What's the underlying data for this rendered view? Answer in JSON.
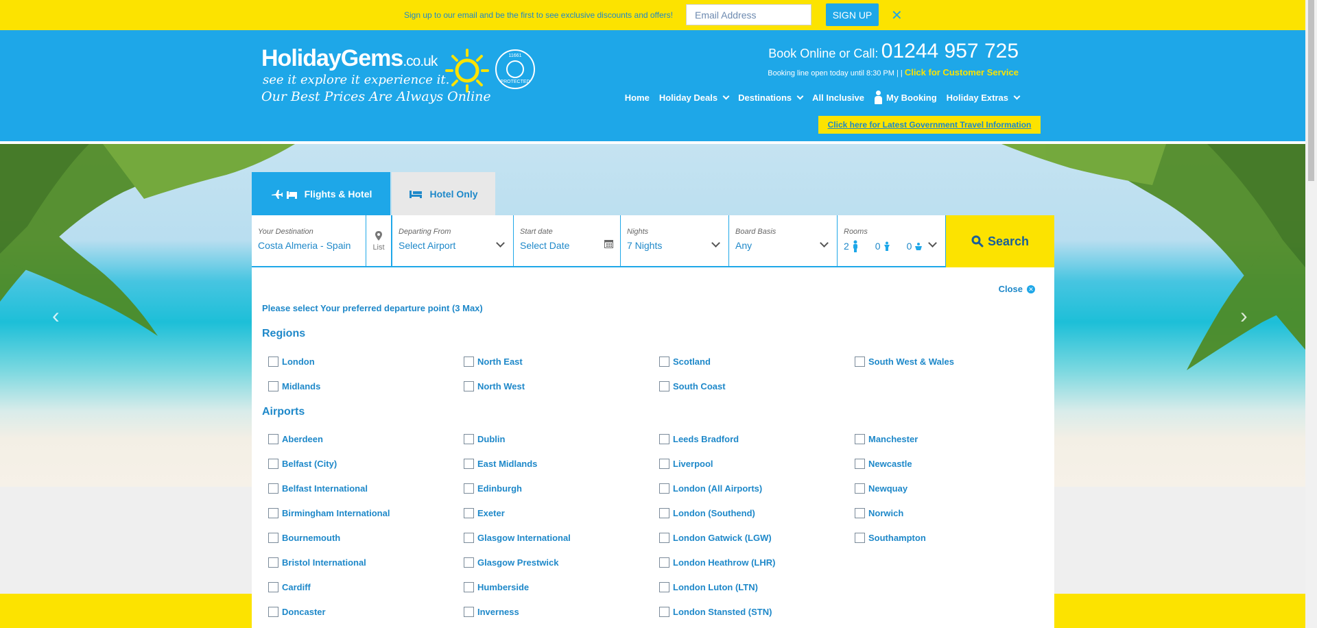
{
  "promo": {
    "text": "Sign up to our email and be the first to see exclusive discounts and offers!",
    "email_placeholder": "Email Address",
    "signup_label": "SIGN UP",
    "close_label": "✕"
  },
  "header": {
    "logo_main": "HolidayGems",
    "logo_tld": ".co.uk",
    "logo_sub": "see it  explore it  experience it.",
    "logo_tag": "Our Best Prices Are Always Online",
    "atol_number": "11661",
    "atol_text": "PROTECTED",
    "book_label": "Book Online or Call:",
    "phone": "01244 957 725",
    "booking_line": "Booking line open today until 8:30 PM | |",
    "customer_service": "Click for Customer Service",
    "nav": {
      "home": "Home",
      "holiday_deals": "Holiday Deals",
      "destinations": "Destinations",
      "all_inclusive": "All Inclusive",
      "my_booking": "My Booking",
      "holiday_extras": "Holiday Extras"
    },
    "gov_info": "Click here for Latest Government Travel Information"
  },
  "search": {
    "tab_flights_hotel": "Flights & Hotel",
    "tab_hotel_only": "Hotel Only",
    "destination_label": "Your Destination",
    "destination_value": "Costa Almeria - Spain",
    "list_label": "List",
    "departing_label": "Departing From",
    "departing_value": "Select Airport",
    "start_label": "Start date",
    "start_value": "Select Date",
    "nights_label": "Nights",
    "nights_value": "7 Nights",
    "board_label": "Board Basis",
    "board_value": "Any",
    "rooms_label": "Rooms",
    "adults": "2",
    "children": "0",
    "infants": "0",
    "search_label": "Search"
  },
  "panel": {
    "close_label": "Close",
    "instruction": "Please select Your preferred departure point (3 Max)",
    "regions_title": "Regions",
    "airports_title": "Airports",
    "regions": [
      "London",
      "North East",
      "Scotland",
      "South West & Wales",
      "Midlands",
      "North West",
      "South Coast"
    ],
    "airports": [
      "Aberdeen",
      "Dublin",
      "Leeds Bradford",
      "Manchester",
      "Belfast (City)",
      "East Midlands",
      "Liverpool",
      "Newcastle",
      "Belfast International",
      "Edinburgh",
      "London (All Airports)",
      "Newquay",
      "Birmingham International",
      "Exeter",
      "London (Southend)",
      "Norwich",
      "Bournemouth",
      "Glasgow International",
      "London Gatwick (LGW)",
      "Southampton",
      "Bristol International",
      "Glasgow Prestwick",
      "London Heathrow (LHR)",
      "Cardiff",
      "Humberside",
      "London Luton (LTN)",
      "Doncaster",
      "Inverness",
      "London Stansted (STN)"
    ]
  },
  "hero": {
    "prev": "‹",
    "next": "›"
  }
}
